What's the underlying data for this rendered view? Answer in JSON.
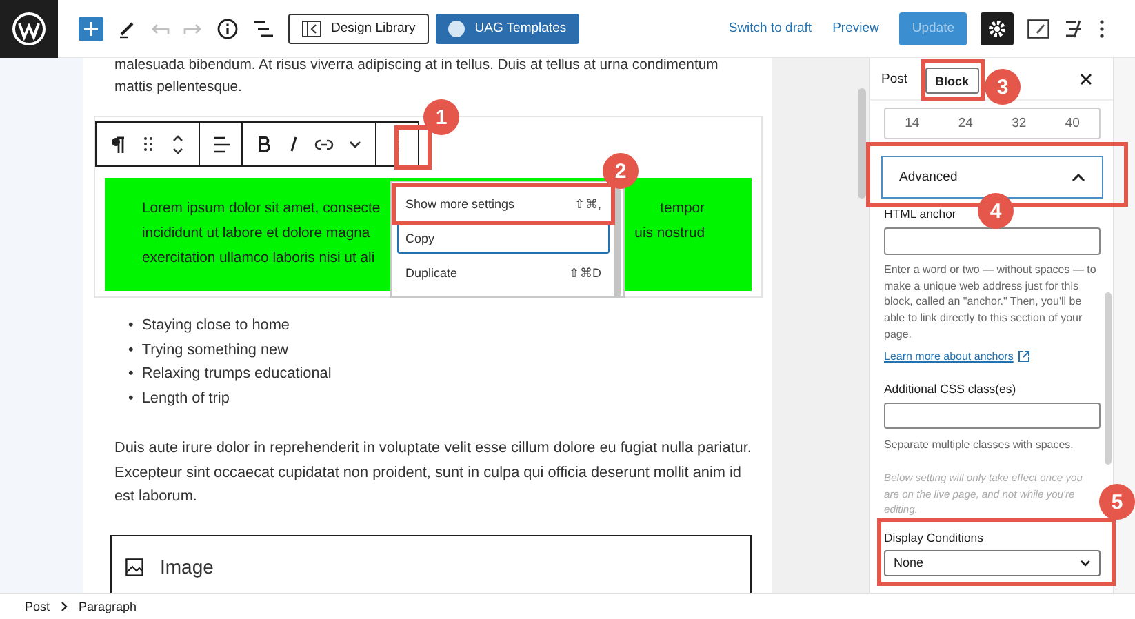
{
  "topbar": {
    "design_library": "Design Library",
    "uag_templates": "UAG Templates",
    "undo": {
      "disabled": true
    },
    "redo": {
      "disabled": true
    },
    "switch_to_draft": "Switch to draft",
    "preview": "Preview",
    "update": {
      "label": "Update",
      "disabled": true
    },
    "settings": {
      "active": true
    }
  },
  "editor": {
    "intro": "malesuada bibendum. At risus viverra adipiscing at in tellus. Duis at tellus at urna condimentum\nmattis pellentesque.",
    "block": {
      "rows": [
        {
          "left": "Lorem ipsum dolor sit amet, consecte",
          "right": "tempor"
        },
        {
          "left": "incididunt ut labore et dolore magna",
          "right": "uis nostrud"
        },
        {
          "left": "exercitation ullamco laboris nisi ut ali"
        }
      ]
    },
    "menu": {
      "items": [
        {
          "label": "Show more settings",
          "shortcut": "⇧⌘,",
          "focused": false
        },
        {
          "label": "Copy",
          "focused": true
        },
        {
          "label": "Duplicate",
          "shortcut": "⇧⌘D",
          "focused": false
        }
      ]
    },
    "list": {
      "marker": "•",
      "items": [
        "Staying close to home",
        "Trying something new",
        "Relaxing trumps educational",
        "Length of trip"
      ]
    },
    "paragraph": "Duis aute irure dolor in reprehenderit in voluptate velit esse cillum dolore eu fugiat nulla pariatur.\nExcepteur sint occaecat cupidatat non proident, sunt in culpa qui officia deserunt mollit anim id\nest laborum.",
    "image_block": "Image"
  },
  "sidebar": {
    "tabs": [
      {
        "label": "Post",
        "selected": false
      },
      {
        "label": "Block",
        "selected": true
      }
    ],
    "font_sizes": [
      "14",
      "24",
      "32",
      "40"
    ],
    "advanced": {
      "title": "Advanced",
      "expanded": true
    },
    "html_anchor": {
      "label": "HTML anchor",
      "help": "Enter a word or two — without spaces — to\nmake a unique web address just for this\nblock, called an \"anchor.\" Then, you'll be\nable to link directly to this section of your\npage.",
      "link": "Learn more about anchors"
    },
    "css_classes": {
      "label": "Additional CSS class(es)",
      "help": "Separate multiple classes with spaces."
    },
    "note": "Below setting will only take effect once you\nare on the live page, and not while you're\nediting.",
    "display_conditions": {
      "label": "Display Conditions",
      "value": "None"
    }
  },
  "breadcrumb": [
    "Post",
    "Paragraph"
  ],
  "annotations": [
    {
      "number": "1"
    },
    {
      "number": "2"
    },
    {
      "number": "3"
    },
    {
      "number": "4"
    },
    {
      "number": "5"
    }
  ]
}
